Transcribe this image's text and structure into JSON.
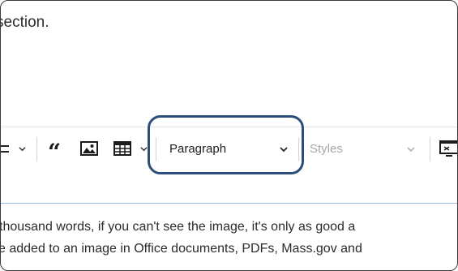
{
  "editor": {
    "intro_text": "section.",
    "body_line_1": "thousand words, if you can't see the image, it's only as good a",
    "body_line_2": "e added to an image in Office documents, PDFs, Mass.gov and"
  },
  "toolbar": {
    "block_format": {
      "selected": "Paragraph"
    },
    "styles": {
      "placeholder": "Styles"
    }
  },
  "colors": {
    "highlight_border": "#2a4e79",
    "editor_focus_line": "#9bb7e8"
  }
}
